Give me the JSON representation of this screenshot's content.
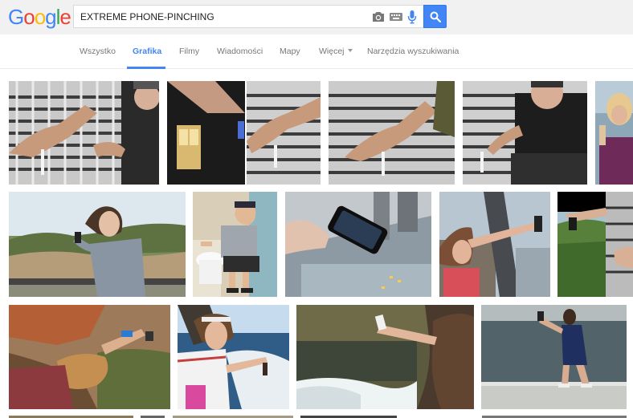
{
  "header": {
    "logo_text": "Google",
    "logo_letters": [
      "G",
      "o",
      "o",
      "g",
      "l",
      "e"
    ],
    "logo_colors": [
      "#4285f4",
      "#ea4335",
      "#fbbc05",
      "#4285f4",
      "#34a853",
      "#ea4335"
    ],
    "search_value": "EXTREME PHONE-PINCHING",
    "icons": [
      "camera-icon",
      "keyboard-icon",
      "microphone-icon",
      "search-icon"
    ]
  },
  "tabs": {
    "all": "Wszystko",
    "images": "Grafika",
    "videos": "Filmy",
    "news": "Wiadomości",
    "maps": "Mapy",
    "more": "Więcej",
    "tools": "Narzędzia wyszukiwania",
    "active_color": "#4285f4"
  },
  "results": {
    "rows": [
      {
        "items": [
          "phone-over-grate-1",
          "elevator-and-grate",
          "phone-over-grate-2",
          "man-on-ledge-phone",
          "woman-with-drink"
        ]
      },
      {
        "items": [
          "boy-canyon-phone",
          "man-toilet-phone",
          "phone-above-city",
          "woman-skyscraper-ledge",
          "phone-over-forest"
        ]
      },
      {
        "items": [
          "woman-cliff-phone",
          "woman-boat-phone",
          "woman-waterfall-phone",
          "woman-fountain-phone"
        ]
      }
    ]
  }
}
